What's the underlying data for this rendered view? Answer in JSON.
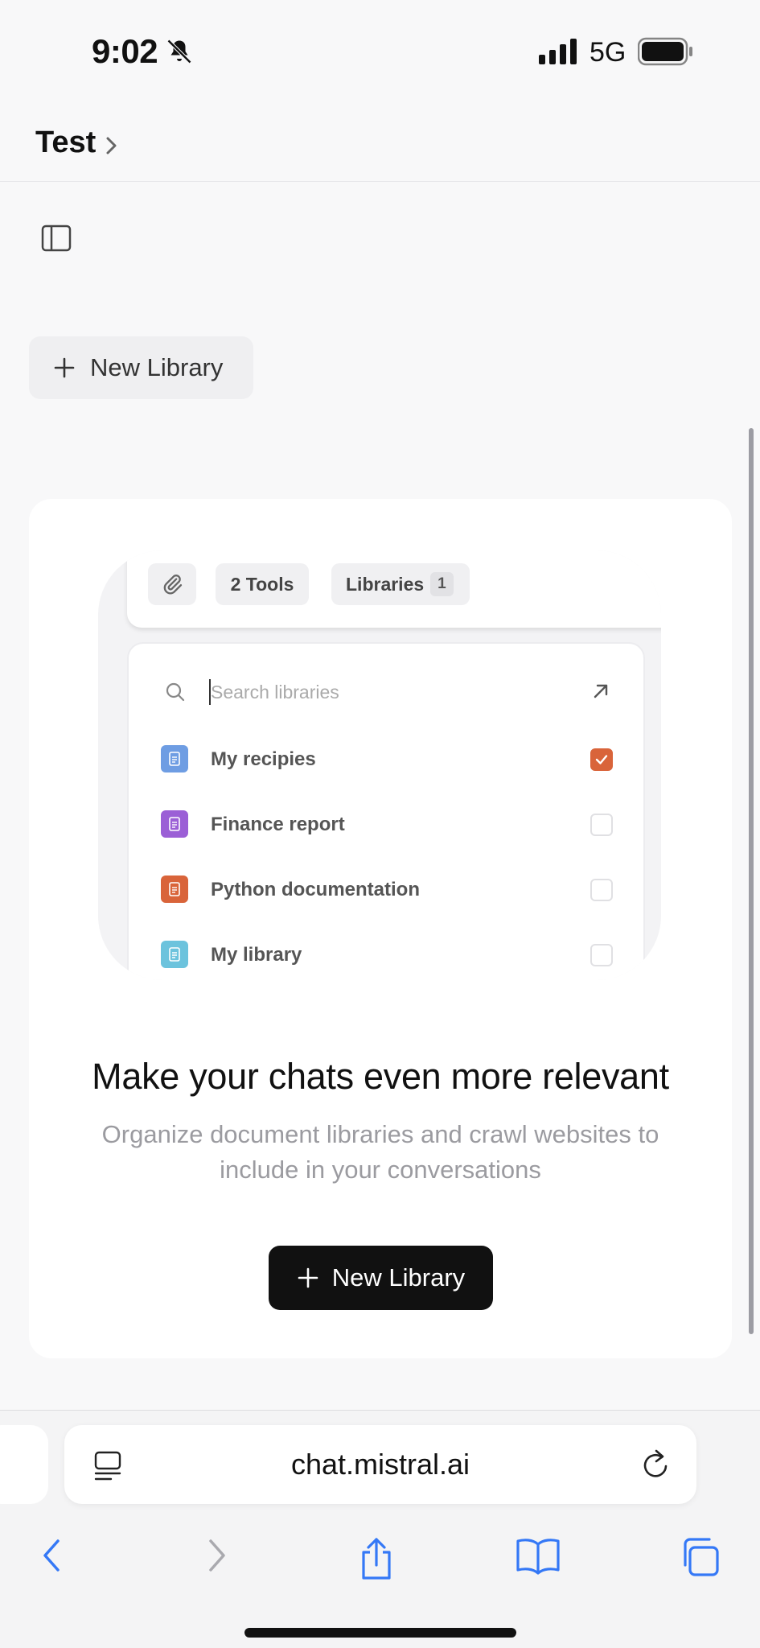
{
  "status_bar": {
    "time": "9:02",
    "network": "5G"
  },
  "header": {
    "title": "Test"
  },
  "new_library_top": {
    "label": "New Library"
  },
  "preview": {
    "tools_label": "2 Tools",
    "libraries_label": "Libraries",
    "libraries_count": "1",
    "search_placeholder": "Search libraries",
    "items": [
      {
        "name": "My recipies",
        "color": "#6e9de3",
        "checked": true
      },
      {
        "name": "Finance report",
        "color": "#9b5fd6",
        "checked": false
      },
      {
        "name": "Python documentation",
        "color": "#d9643a",
        "checked": false
      },
      {
        "name": "My library",
        "color": "#6cc3dd",
        "checked": false
      }
    ]
  },
  "card": {
    "title": "Make your chats even more relevant",
    "subtitle": "Organize document libraries and crawl websites to include in your conversations",
    "button_label": "New Library"
  },
  "browser": {
    "url": "chat.mistral.ai"
  },
  "colors": {
    "accent": "#d9643a",
    "safari_blue": "#3478f6"
  }
}
